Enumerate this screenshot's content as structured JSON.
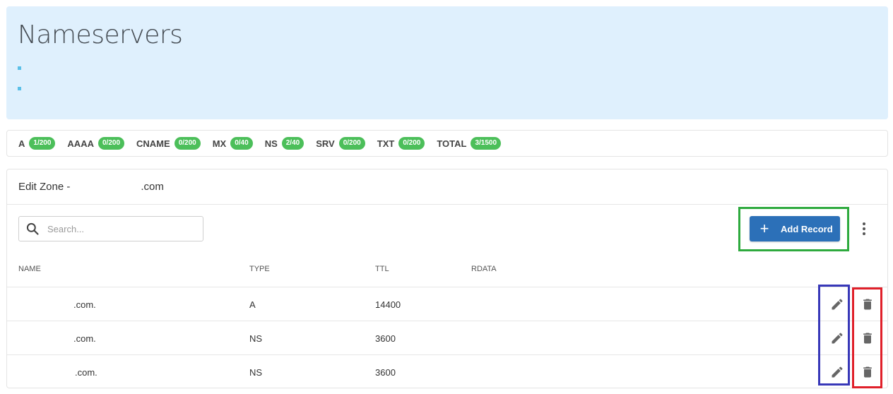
{
  "nameservers": {
    "title": "Nameservers",
    "items": [
      "",
      ""
    ]
  },
  "record_counts": [
    {
      "type": "A",
      "count": "1/200"
    },
    {
      "type": "AAAA",
      "count": "0/200"
    },
    {
      "type": "CNAME",
      "count": "0/200"
    },
    {
      "type": "MX",
      "count": "0/40"
    },
    {
      "type": "NS",
      "count": "2/40"
    },
    {
      "type": "SRV",
      "count": "0/200"
    },
    {
      "type": "TXT",
      "count": "0/200"
    },
    {
      "type": "TOTAL",
      "count": "3/1500"
    }
  ],
  "zone": {
    "title": "Edit Zone -",
    "domain": ".com"
  },
  "search": {
    "placeholder": "Search...",
    "value": ""
  },
  "toolbar": {
    "add_icon": "+",
    "add_label": "Add Record",
    "more_icon": "more-vertical-icon"
  },
  "table": {
    "columns": [
      "NAME",
      "TYPE",
      "TTL",
      "RDATA"
    ],
    "rows": [
      {
        "name": ".com.",
        "type": "A",
        "ttl": "14400",
        "rdata": ""
      },
      {
        "name": ".com.",
        "type": "NS",
        "ttl": "3600",
        "rdata": ""
      },
      {
        "name": ".com.",
        "type": "NS",
        "ttl": "3600",
        "rdata": ""
      }
    ]
  },
  "colors": {
    "accent": "#2c70b8",
    "badge": "#4cbf5a",
    "panel_bg": "#dff0fd",
    "highlight_add": "#2eaa3e",
    "highlight_edit": "#3838b8",
    "highlight_delete": "#e0202a"
  }
}
